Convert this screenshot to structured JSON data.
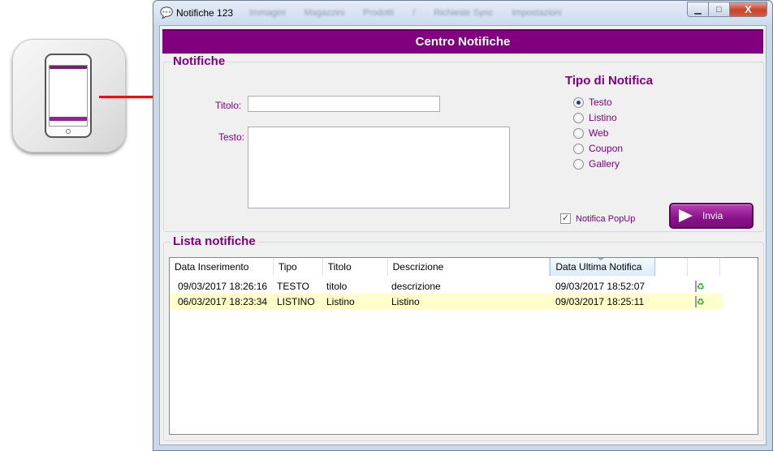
{
  "window": {
    "title": "Notifiche 123",
    "blurred_menu": [
      "Immagini",
      "Magazzini",
      "Prodotti",
      "/",
      "Richieste Sync",
      "Impostazioni"
    ],
    "close_label": "X"
  },
  "header": {
    "title": "Centro Notifiche"
  },
  "form": {
    "group_title": "Notifiche",
    "titolo_label": "Titolo:",
    "titolo_value": "",
    "testo_label": "Testo:",
    "testo_value": ""
  },
  "tipo": {
    "title": "Tipo di Notifica",
    "options": [
      {
        "label": "Testo",
        "checked": true
      },
      {
        "label": "Listino",
        "checked": false
      },
      {
        "label": "Web",
        "checked": false
      },
      {
        "label": "Coupon",
        "checked": false
      },
      {
        "label": "Gallery",
        "checked": false
      }
    ]
  },
  "popup": {
    "label": "Notifica PopUp",
    "checked": true
  },
  "send_button": {
    "label": "Invia"
  },
  "lista": {
    "group_title": "Lista notifiche",
    "columns": [
      "Data Inserimento",
      "Tipo",
      "Titolo",
      "Descrizione",
      "Data Ultima Notifica",
      "",
      "",
      ""
    ],
    "rows": [
      {
        "data_inserimento": "09/03/2017 18:26:16",
        "tipo": "TESTO",
        "titolo": "titolo",
        "descrizione": "descrizione",
        "data_ultima": "09/03/2017 18:52:07"
      },
      {
        "data_inserimento": "06/03/2017 18:23:34",
        "tipo": "LISTINO",
        "titolo": "Listino",
        "descrizione": "Listino",
        "data_ultima": "09/03/2017 18:25:11"
      }
    ]
  },
  "colors": {
    "brand": "#800080",
    "selected_row": "#ffffcc",
    "arrow": "#e81010"
  },
  "icons": {
    "app": "smartphone-app-icon",
    "resend": "mail-send-icon",
    "delete": "recycle-bin-icon"
  }
}
